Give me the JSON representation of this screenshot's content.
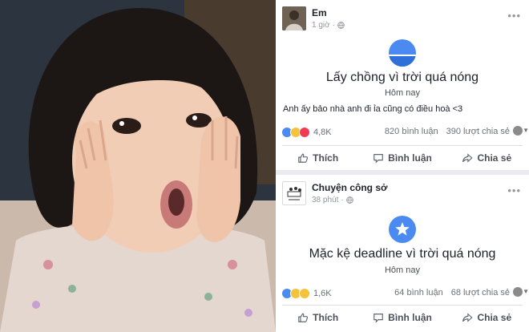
{
  "post1": {
    "author": "Em",
    "time": "1 giờ",
    "event_title": "Lấy chồng vì trời quá nóng",
    "event_subtitle": "Hôm nay",
    "text": "Anh ấy bảo nhà anh đi ỉa cũng có điều hoà <3",
    "reaction_count": "4,8K",
    "comments": "820 bình luận",
    "shares": "390 lượt chia sẻ"
  },
  "post2": {
    "author": "Chuyện công sở",
    "time": "38 phút",
    "event_title": "Mặc kệ deadline vì trời quá nóng",
    "event_subtitle": "Hôm nay",
    "reaction_count": "1,6K",
    "comments": "64 bình luận",
    "shares": "68 lượt chia sẻ"
  },
  "actions": {
    "like": "Thích",
    "comment": "Bình luận",
    "share": "Chia sẻ"
  },
  "colors": {
    "accent": "#4b8af0",
    "text": "#1d2129",
    "muted": "#90949c",
    "divider": "#dddfe2"
  },
  "icons": {
    "globe": "globe-icon",
    "like": "thumbs-up-icon",
    "comment": "comment-bubble-icon",
    "share": "share-arrow-icon",
    "menu": "more-dots-icon",
    "event1": "horizon-icon",
    "event2": "star-icon"
  }
}
